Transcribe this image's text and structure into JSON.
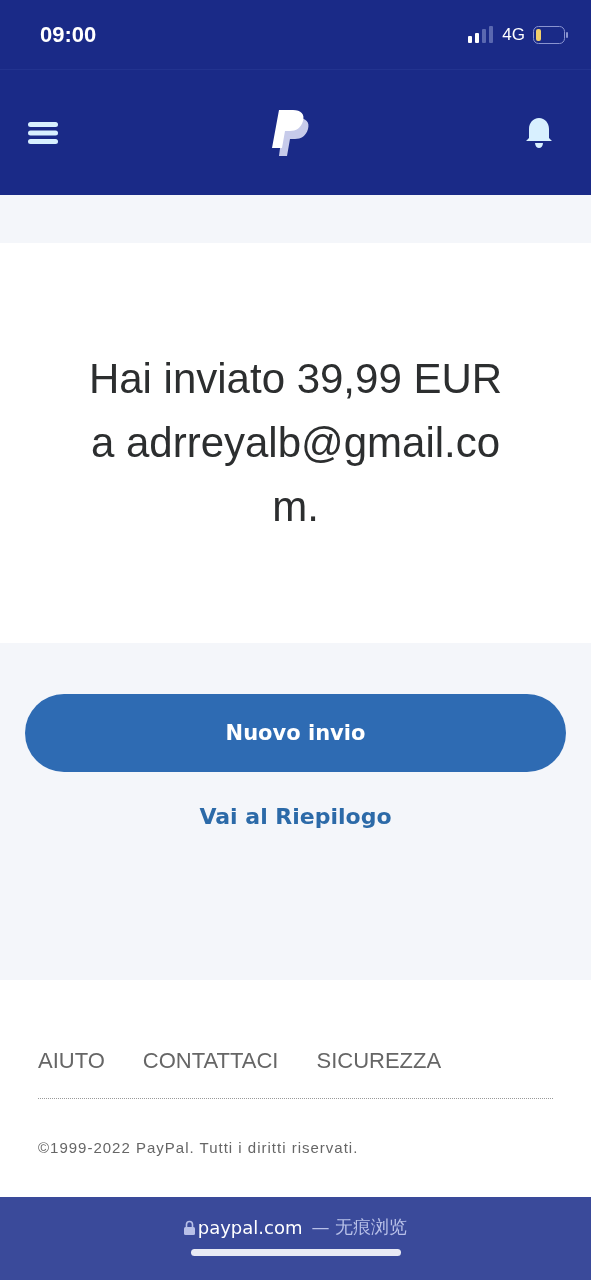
{
  "status_bar": {
    "time": "09:00",
    "network": "4G"
  },
  "confirmation": {
    "message": "Hai inviato 39,99 EUR a adrreyalb@gmail.com."
  },
  "actions": {
    "primary": "Nuovo invio",
    "secondary": "Vai al Riepilogo"
  },
  "footer": {
    "links": [
      "AIUTO",
      "CONTATTACI",
      "SICUREZZA"
    ],
    "copyright": "©1999-2022 PayPal. Tutti i diritti riservati."
  },
  "browser_bar": {
    "domain": "paypal.com",
    "mode": "— 无痕浏览"
  }
}
